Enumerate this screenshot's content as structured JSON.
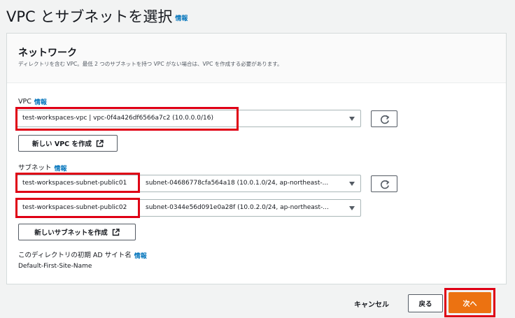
{
  "page": {
    "title": "VPC とサブネットを選択",
    "info": "情報"
  },
  "network": {
    "title": "ネットワーク",
    "description": "ディレクトリを含む VPC。最低 2 つのサブネットを持つ VPC がない場合は、VPC を作成する必要があります。"
  },
  "vpc": {
    "label": "VPC",
    "info": "情報",
    "selected": "test-workspaces-vpc | vpc-0f4a426df6566a7c2 (10.0.0.0/16)",
    "create_button": "新しい VPC を作成"
  },
  "subnet": {
    "label": "サブネット",
    "info": "情報",
    "items": [
      {
        "name": "test-workspaces-subnet-public01",
        "detail": "subnet-04686778cfa564a18 (10.0.1.0/24, ap-northeast-..."
      },
      {
        "name": "test-workspaces-subnet-public02",
        "detail": "subnet-0344e56d091e0a28f (10.0.2.0/24, ap-northeast-..."
      }
    ],
    "create_button": "新しいサブネットを作成"
  },
  "ad_site": {
    "label": "このディレクトリの初期 AD サイト名",
    "info": "情報",
    "value": "Default-First-Site-Name"
  },
  "footer": {
    "cancel": "キャンセル",
    "back": "戻る",
    "next": "次へ"
  },
  "colors": {
    "accent": "#ec7211",
    "link": "#0073bb",
    "highlight": "#df0015"
  },
  "icons": [
    "refresh-icon",
    "external-link-icon",
    "caret-down-icon"
  ]
}
